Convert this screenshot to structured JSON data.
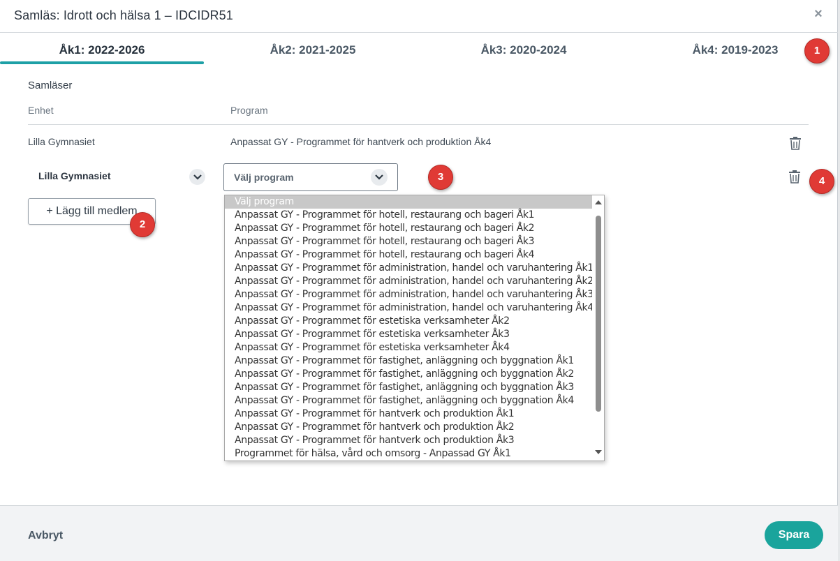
{
  "dialog": {
    "title": "Samläs: Idrott och hälsa 1 – IDCIDR51",
    "close_glyph": "×"
  },
  "tabs": [
    {
      "label": "Åk1: 2022-2026",
      "active": true
    },
    {
      "label": "Åk2: 2021-2025",
      "active": false
    },
    {
      "label": "Åk3: 2020-2024",
      "active": false
    },
    {
      "label": "Åk4: 2019-2023",
      "active": false
    }
  ],
  "section": {
    "title": "Samläser",
    "col_unit": "Enhet",
    "col_program": "Program"
  },
  "existing_row": {
    "unit": "Lilla Gymnasiet",
    "program": "Anpassat GY - Programmet för hantverk och produktion Åk4"
  },
  "new_row": {
    "unit_value": "Lilla Gymnasiet",
    "program_placeholder": "Välj program"
  },
  "add_member_label": "+ Lägg till medlem",
  "dropdown": {
    "options": [
      "Välj program",
      "Anpassat GY - Programmet för hotell, restaurang och bageri Åk1",
      "Anpassat GY - Programmet för hotell, restaurang och bageri Åk2",
      "Anpassat GY - Programmet för hotell, restaurang och bageri Åk3",
      "Anpassat GY - Programmet för hotell, restaurang och bageri Åk4",
      "Anpassat GY - Programmet för administration, handel och varuhantering Åk1",
      "Anpassat GY - Programmet för administration, handel och varuhantering Åk2",
      "Anpassat GY - Programmet för administration, handel och varuhantering Åk3",
      "Anpassat GY - Programmet för administration, handel och varuhantering Åk4",
      "Anpassat GY - Programmet för estetiska verksamheter Åk2",
      "Anpassat GY - Programmet för estetiska verksamheter Åk3",
      "Anpassat GY - Programmet för estetiska verksamheter Åk4",
      "Anpassat GY - Programmet för fastighet, anläggning och byggnation Åk1",
      "Anpassat GY - Programmet för fastighet, anläggning och byggnation Åk2",
      "Anpassat GY - Programmet för fastighet, anläggning och byggnation Åk3",
      "Anpassat GY - Programmet för fastighet, anläggning och byggnation Åk4",
      "Anpassat GY - Programmet för hantverk och produktion Åk1",
      "Anpassat GY - Programmet för hantverk och produktion Åk2",
      "Anpassat GY - Programmet för hantverk och produktion Åk3",
      "Programmet för hälsa, vård och omsorg - Anpassad GY Åk1"
    ],
    "selected_index": 0
  },
  "footer": {
    "cancel_label": "Avbryt",
    "save_label": "Spara"
  },
  "annotations": [
    "1",
    "2",
    "3",
    "4"
  ],
  "colors": {
    "accent": "#1ea0a6",
    "save_button": "#1aa49c",
    "badge": "#e03a35"
  },
  "icons": {
    "close": "close-icon",
    "trash": "trash-icon",
    "chevron": "chevron-down-icon"
  }
}
